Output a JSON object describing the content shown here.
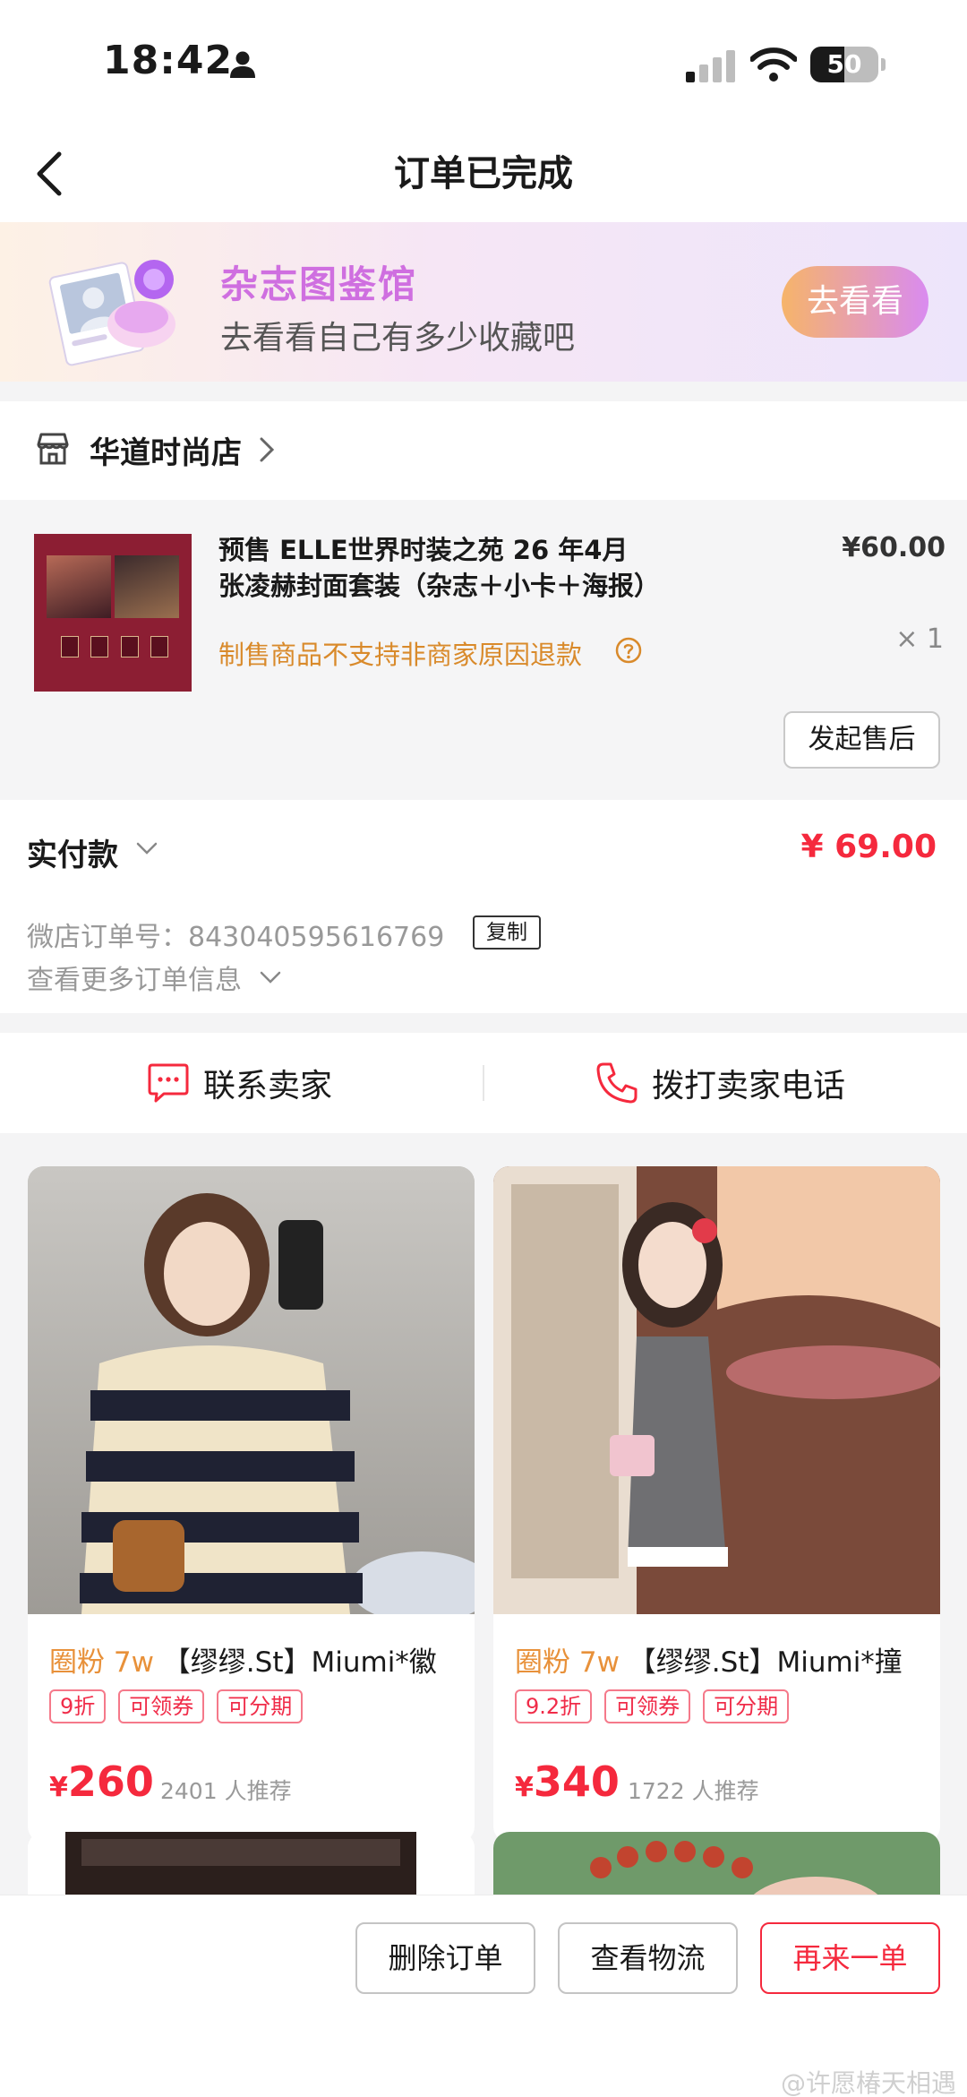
{
  "status_bar": {
    "time": "18:42",
    "battery": "50",
    "battery_level": 0.5
  },
  "nav": {
    "title": "订单已完成"
  },
  "banner": {
    "title": "杂志图鉴馆",
    "subtitle": "去看看自己有多少收藏吧",
    "button": "去看看"
  },
  "shop": {
    "name": "华道时尚店"
  },
  "product": {
    "title_line1": "预售 ELLE世界时装之苑 26 年4月",
    "title_line2": "张凌赫封面套装（杂志＋小卡＋海报）",
    "price": "¥60.00",
    "quantity": "× 1",
    "notice": "制售商品不支持非商家原因退款",
    "aftersale_button": "发起售后"
  },
  "payment": {
    "label": "实付款",
    "amount": "¥ 69.00",
    "order_number": "微店订单号：843040595616769",
    "copy_button": "复制",
    "more_info": "查看更多订单信息"
  },
  "contact": {
    "seller": "联系卖家",
    "phone": "拨打卖家电话"
  },
  "recommendations": [
    {
      "fans": "圈粉 7w",
      "title": "【缪缪.St】Miumi*徽",
      "tags": [
        "9折",
        "可领券",
        "可分期"
      ],
      "currency": "¥",
      "price": "260",
      "recommend": "2401 人推荐"
    },
    {
      "fans": "圈粉 7w",
      "title": "【缪缪.St】Miumi*撞",
      "tags": [
        "9.2折",
        "可领券",
        "可分期"
      ],
      "currency": "¥",
      "price": "340",
      "recommend": "1722 人推荐"
    }
  ],
  "bottom": {
    "delete": "删除订单",
    "logistics": "查看物流",
    "reorder": "再来一单"
  },
  "watermark": "@许愿椿天相遇",
  "colors": {
    "accent": "#f5293d",
    "notice": "#d98a2b",
    "fans": "#e8913a",
    "banner_title": "#cf6fe0"
  },
  "icons": [
    "person-icon",
    "signal-icon",
    "wifi-icon",
    "back-icon",
    "shop-icon",
    "chevron-right-icon",
    "help-icon",
    "chevron-down-icon",
    "chat-icon",
    "phone-icon"
  ]
}
